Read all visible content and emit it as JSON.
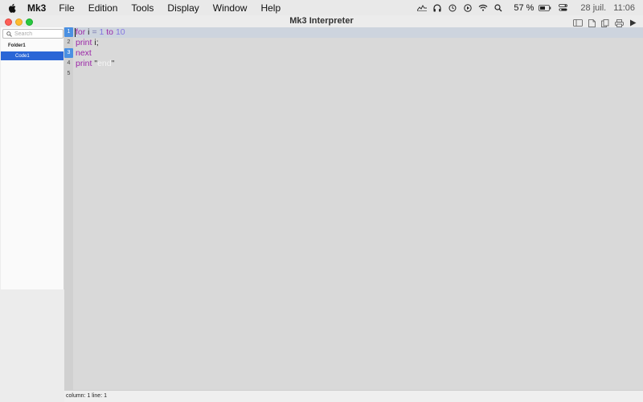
{
  "menubar": {
    "app_name": "Mk3",
    "menus": [
      "File",
      "Edition",
      "Tools",
      "Display",
      "Window",
      "Help"
    ],
    "battery_percent": "57 %",
    "date": "28 juil.",
    "time": "11:06",
    "icons": [
      "apple-icon",
      "activity-icon",
      "headphones-icon",
      "time-machine-icon",
      "play-icon",
      "wifi-icon",
      "search-icon",
      "battery-icon",
      "control-center-icon"
    ]
  },
  "window": {
    "title": "Mk3 Interpreter",
    "toolbar_icons": [
      "sidebar-toggle-icon",
      "new-document-icon",
      "copy-document-icon",
      "print-icon",
      "run-icon"
    ]
  },
  "sidebar": {
    "search_placeholder": "Search",
    "folder": "Folder1",
    "items": [
      {
        "label": "Code1",
        "selected": true
      }
    ]
  },
  "editor": {
    "line_numbers": [
      "1",
      "2",
      "3",
      "4",
      "5"
    ],
    "current_line": 1,
    "lines": [
      {
        "t": [
          {
            "text": "for",
            "c": "kw"
          },
          {
            "text": " i ",
            "c": "plain"
          },
          {
            "text": "=",
            "c": "op"
          },
          {
            "text": " 1 ",
            "c": "num"
          },
          {
            "text": "to",
            "c": "kw"
          },
          {
            "text": " 10",
            "c": "num"
          }
        ]
      },
      {
        "t": [
          {
            "text": "print",
            "c": "kw"
          },
          {
            "text": " i;",
            "c": "plain"
          }
        ]
      },
      {
        "t": [
          {
            "text": "next",
            "c": "kw"
          }
        ]
      },
      {
        "t": [
          {
            "text": "print",
            "c": "kw"
          },
          {
            "text": " \"",
            "c": "strq"
          },
          {
            "text": "end",
            "c": "str"
          },
          {
            "text": "\"",
            "c": "strq"
          }
        ]
      },
      {
        "t": []
      }
    ],
    "colors": {
      "keyword": "#9b27a8",
      "number": "#8577e0",
      "selection": "#2a66d6"
    }
  },
  "statusbar": {
    "text": "column: 1 line: 1"
  }
}
